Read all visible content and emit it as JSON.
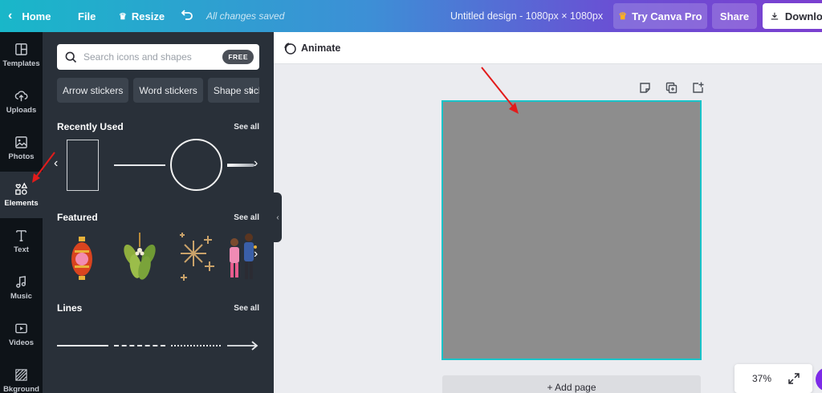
{
  "topbar": {
    "home_label": "Home",
    "file_label": "File",
    "resize_label": "Resize",
    "saved_status": "All changes saved",
    "doc_title": "Untitled design - 1080px × 1080px",
    "pro_label": "Try Canva Pro",
    "share_label": "Share",
    "download_label": "Download",
    "gradient_start": "#19b7c9",
    "gradient_end": "#7b3fd0"
  },
  "rail": {
    "items": [
      {
        "label": "Templates",
        "icon": "templates-icon"
      },
      {
        "label": "Uploads",
        "icon": "upload-cloud-icon"
      },
      {
        "label": "Photos",
        "icon": "photo-icon"
      },
      {
        "label": "Elements",
        "icon": "shapes-icon",
        "active": true
      },
      {
        "label": "Text",
        "icon": "text-icon"
      },
      {
        "label": "Music",
        "icon": "music-note-icon"
      },
      {
        "label": "Videos",
        "icon": "video-icon"
      },
      {
        "label": "Bkground",
        "icon": "background-icon"
      }
    ]
  },
  "panel": {
    "search_placeholder": "Search icons and shapes",
    "free_badge": "FREE",
    "chips": [
      "Arrow stickers",
      "Word stickers",
      "Shape stickers"
    ],
    "recently_used": {
      "title": "Recently Used",
      "see_all": "See all"
    },
    "featured": {
      "title": "Featured",
      "see_all": "See all"
    },
    "lines": {
      "title": "Lines",
      "see_all": "See all"
    }
  },
  "toolbar": {
    "animate_label": "Animate"
  },
  "canvas": {
    "page_fill": "#8d8d8d",
    "selection_color": "#19c3c9",
    "add_page_label": "+ Add page",
    "zoom": "37%"
  },
  "colors": {
    "panel_bg": "#293039",
    "rail_bg": "#0e1318",
    "annotation_red": "#e21b1b"
  }
}
